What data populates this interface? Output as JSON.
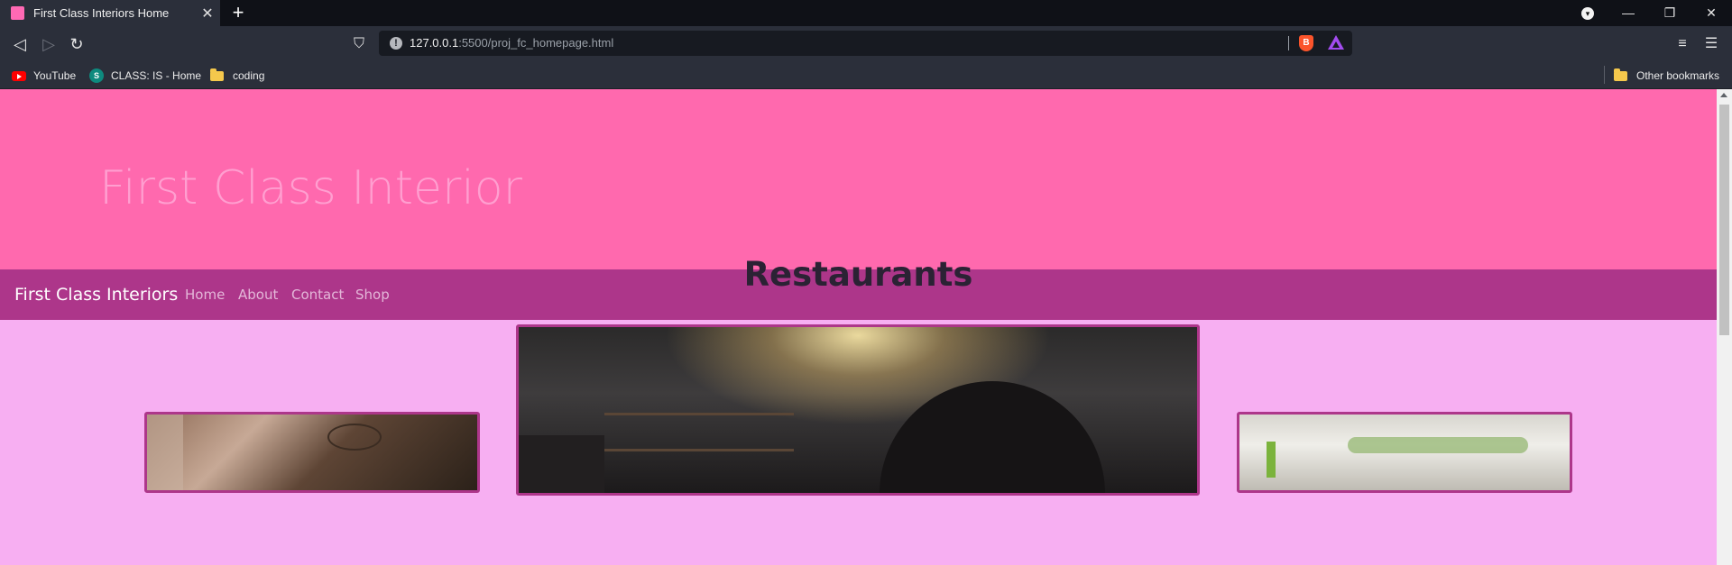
{
  "browser": {
    "tab_title": "First Class Interiors Home",
    "tab_close": "✕",
    "new_tab": "+",
    "url_host": "127.0.0.1",
    "url_rest": ":5500/proj_fc_homepage.html",
    "window_controls": {
      "minimize": "—",
      "restore": "❐",
      "close": "✕"
    },
    "bookmarks": [
      {
        "label": "YouTube",
        "icon": "youtube-icon"
      },
      {
        "label": "CLASS: IS - Home",
        "icon": "sharepoint-icon"
      },
      {
        "label": "coding",
        "icon": "folder-icon"
      }
    ],
    "other_bookmarks": "Other bookmarks"
  },
  "hero": {
    "title": "First Class Interior"
  },
  "nav": {
    "brand": "First Class Interiors",
    "links": [
      "Home",
      "About",
      "Contact",
      "Shop"
    ]
  },
  "section": {
    "title": "Restaurants"
  },
  "colors": {
    "hero_bg": "#ff69ae",
    "nav_bg": "#ad368a",
    "page_bg": "#f7aff2",
    "photo_border": "#ad368a"
  }
}
